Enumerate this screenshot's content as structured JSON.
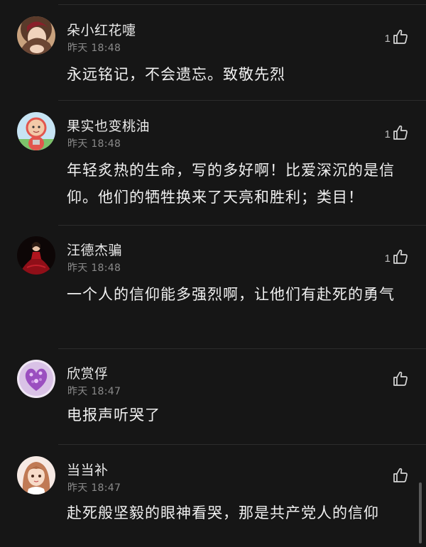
{
  "comments": [
    {
      "username": "朵小红花嚏",
      "time": "昨天 18:48",
      "text": "永远铭记，不会遗忘。致敬先烈",
      "likes": "1",
      "avatar": "girl-portrait-avatar"
    },
    {
      "username": "果实也变桃油",
      "time": "昨天 18:48",
      "text": "年轻炙热的生命，写的多好啊！比爱深沉的是信仰。他们的牺牲换来了天亮和胜利；类目！",
      "likes": "1",
      "avatar": "teletubby-avatar"
    },
    {
      "username": "汪德杰骗",
      "time": "昨天 18:48",
      "text": "一个人的信仰能多强烈啊，让他们有赴死的勇气",
      "likes": "1",
      "avatar": "red-dress-avatar"
    },
    {
      "username": "欣赏俘",
      "time": "昨天 18:47",
      "text": "电报声听哭了",
      "likes": "",
      "avatar": "purple-heart-avatar"
    },
    {
      "username": "当当补",
      "time": "昨天 18:47",
      "text": "赴死般坚毅的眼神看哭，那是共产党人的信仰",
      "likes": "",
      "avatar": "anime-girl-avatar"
    }
  ],
  "colors": {
    "background": "#161616",
    "divider": "#2c2c2c",
    "primary_text": "#f0f0f0",
    "secondary_text": "#8a8a8a"
  },
  "icons": {
    "like": "thumbs-up-icon"
  }
}
